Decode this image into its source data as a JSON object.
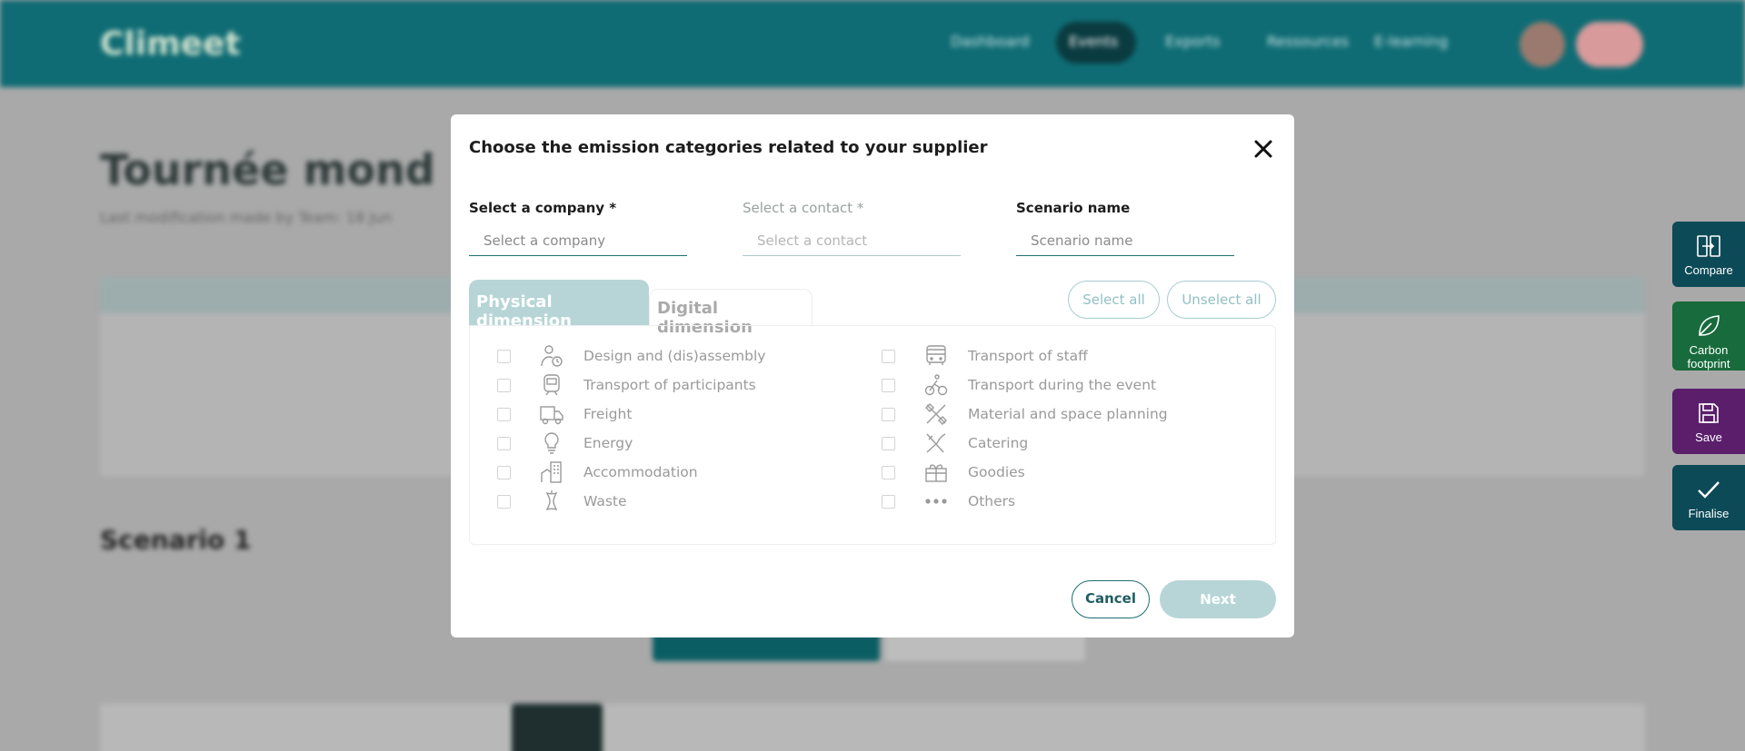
{
  "background": {
    "logo": "Climeet",
    "nav": [
      "Dashboard",
      "Events",
      "Exports",
      "Ressources",
      "E-learning"
    ],
    "page_title": "Tournée mond",
    "page_sub": "Last modification made by Team: 18 Jun",
    "scenario_label": "Scenario 1"
  },
  "side_actions": [
    {
      "label": "Compare",
      "icon": "compare-icon"
    },
    {
      "label": "Carbon footprint",
      "icon": "leaf-icon"
    },
    {
      "label": "Save",
      "icon": "save-icon"
    },
    {
      "label": "Finalise",
      "icon": "check-icon"
    }
  ],
  "modal": {
    "title": "Choose the emission categories related to your supplier",
    "company": {
      "label": "Select a company *",
      "placeholder": "Select a company"
    },
    "contact": {
      "label": "Select a contact *",
      "placeholder": "Select a contact"
    },
    "scenario": {
      "label": "Scenario name",
      "placeholder": "Scenario name"
    },
    "tabs": [
      "Physical dimension",
      "Digital dimension"
    ],
    "select_all": "Select all",
    "unselect_all": "Unselect all",
    "categories_left": [
      {
        "label": "Design and (dis)assembly",
        "icon": "person-clock-icon"
      },
      {
        "label": "Transport of participants",
        "icon": "train-icon"
      },
      {
        "label": "Freight",
        "icon": "truck-icon"
      },
      {
        "label": "Energy",
        "icon": "lightbulb-icon"
      },
      {
        "label": "Accommodation",
        "icon": "building-icon"
      },
      {
        "label": "Waste",
        "icon": "apple-core-icon"
      }
    ],
    "categories_right": [
      {
        "label": "Transport of staff",
        "icon": "bus-icon"
      },
      {
        "label": "Transport during the event",
        "icon": "bike-icon"
      },
      {
        "label": "Material and space planning",
        "icon": "tools-icon"
      },
      {
        "label": "Catering",
        "icon": "cutlery-icon"
      },
      {
        "label": "Goodies",
        "icon": "gift-icon"
      },
      {
        "label": "Others",
        "icon": "dots-icon"
      }
    ],
    "cancel": "Cancel",
    "next": "Next"
  }
}
